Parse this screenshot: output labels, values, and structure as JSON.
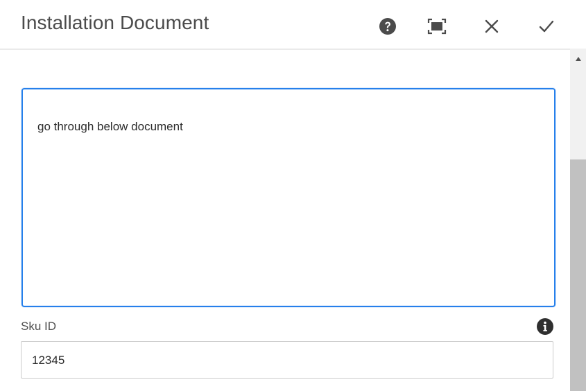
{
  "dialog": {
    "title": "Installation Document",
    "header_buttons": [
      {
        "name": "help",
        "icon": "help-circle-icon"
      },
      {
        "name": "fullscreen",
        "icon": "fullscreen-icon"
      },
      {
        "name": "close",
        "icon": "close-icon"
      },
      {
        "name": "done",
        "icon": "checkmark-icon"
      }
    ]
  },
  "form": {
    "description": {
      "value": "go through below document"
    },
    "sku": {
      "label": "Sku ID",
      "value": "12345",
      "info_icon": "info-icon"
    }
  },
  "colors": {
    "accent": "#2680eb",
    "title_text": "#4b4b4b",
    "icon": "#4b4b4b",
    "scroll_thumb": "#c1c1c1",
    "scroll_track": "#f1f1f1"
  }
}
